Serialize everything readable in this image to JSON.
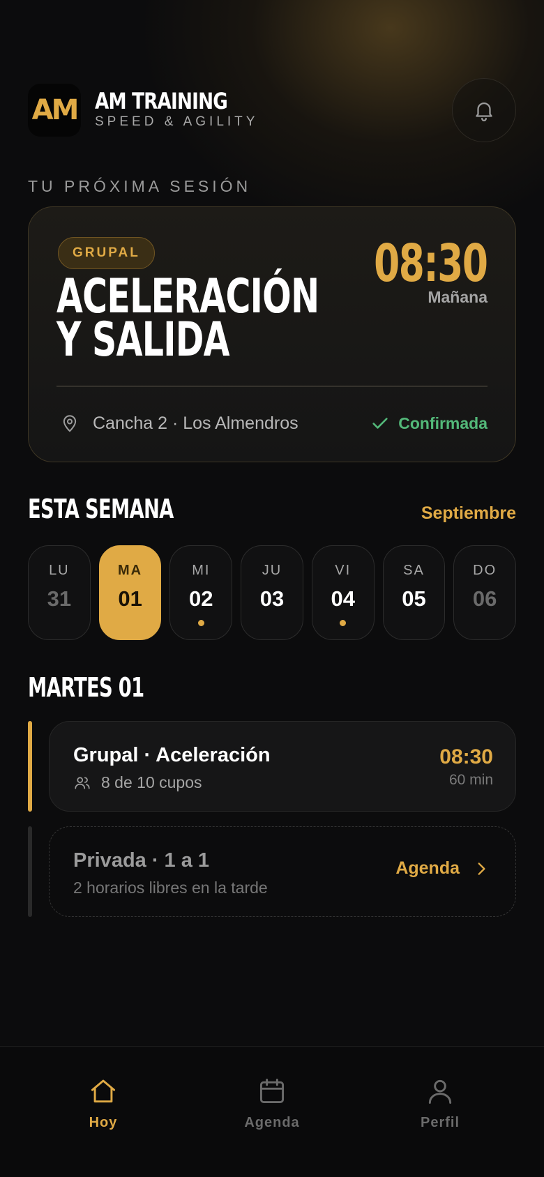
{
  "brand": {
    "logo_text": "AM",
    "name": "AM TRAINING",
    "tagline": "SPEED & AGILITY"
  },
  "next_session": {
    "section_label": "TU PRÓXIMA SESIÓN",
    "badge": "GRUPAL",
    "title_line1": "ACELERACIÓN",
    "title_line2": "Y SALIDA",
    "time": "08:30",
    "when": "Mañana",
    "location": "Cancha 2 · Los Almendros",
    "status": "Confirmada"
  },
  "week": {
    "title": "ESTA SEMANA",
    "month": "Septiembre",
    "days": [
      {
        "name": "LU",
        "num": "31",
        "state": "muted",
        "dot": false
      },
      {
        "name": "MA",
        "num": "01",
        "state": "selected",
        "dot": false
      },
      {
        "name": "MI",
        "num": "02",
        "state": "normal",
        "dot": true
      },
      {
        "name": "JU",
        "num": "03",
        "state": "normal",
        "dot": false
      },
      {
        "name": "VI",
        "num": "04",
        "state": "normal",
        "dot": true
      },
      {
        "name": "SA",
        "num": "05",
        "state": "normal",
        "dot": false
      },
      {
        "name": "DO",
        "num": "06",
        "state": "muted",
        "dot": false
      }
    ]
  },
  "day_detail": {
    "title": "MARTES 01",
    "slots": [
      {
        "title": "Grupal · Aceleración",
        "subtitle": "8 de 10 cupos",
        "time": "08:30",
        "duration": "60 min"
      },
      {
        "title": "Privada · 1 a 1",
        "subtitle": "2 horarios libres en la tarde",
        "action": "Agenda"
      }
    ]
  },
  "nav": {
    "items": [
      {
        "label": "Hoy",
        "icon": "home-icon",
        "active": true
      },
      {
        "label": "Agenda",
        "icon": "calendar-icon",
        "active": false
      },
      {
        "label": "Perfil",
        "icon": "user-icon",
        "active": false
      }
    ]
  },
  "colors": {
    "accent": "#e0aa45",
    "success": "#53b879",
    "background": "#0c0c0d"
  }
}
